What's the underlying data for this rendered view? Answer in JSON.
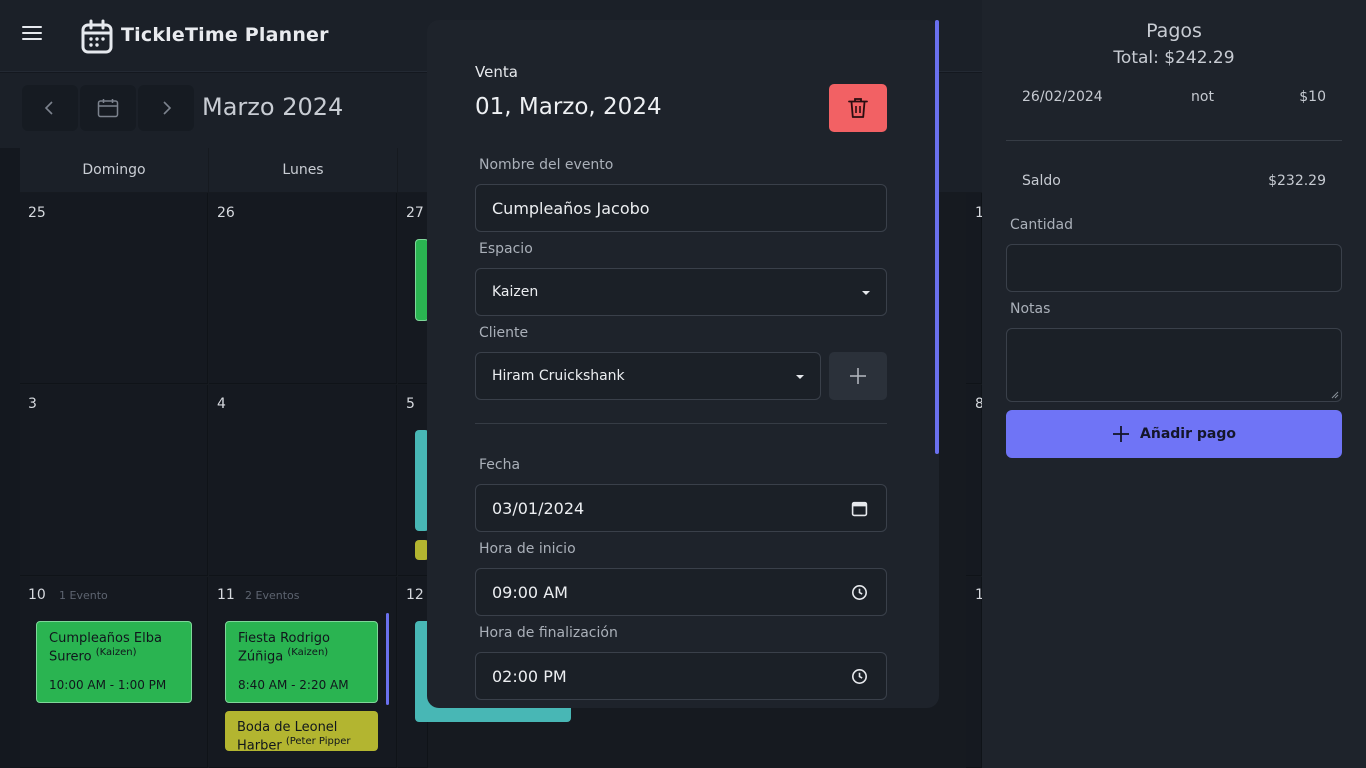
{
  "app": {
    "title": "TickleTime Planner"
  },
  "calendar": {
    "month_title": "Marzo 2024",
    "weekdays": [
      "Domingo",
      "Lunes"
    ],
    "cells": [
      {
        "day": "25"
      },
      {
        "day": "26"
      },
      {
        "day": "27"
      },
      {
        "day": "1"
      },
      {
        "day": "3"
      },
      {
        "day": "4"
      },
      {
        "day": "5"
      },
      {
        "day": "8"
      },
      {
        "day": "10",
        "count": "1 Evento"
      },
      {
        "day": "11",
        "count": "2 Eventos"
      },
      {
        "day": "12"
      },
      {
        "day": "1"
      }
    ],
    "events": [
      {
        "title": "Cumpleaños Elba Surero",
        "tag": "(Kaizen)",
        "time": "10:00 AM - 1:00 PM"
      },
      {
        "title": "Fiesta Rodrigo Zúñiga",
        "tag": "(Kaizen)",
        "time": "8:40 AM - 2:20 AM"
      },
      {
        "title": "Boda de Leonel Harber",
        "tag": "(Peter Pipper"
      }
    ],
    "colors": {
      "green": "#2ab451",
      "teal": "#48b7b5",
      "olive": "#b3b530"
    }
  },
  "modal": {
    "type": "Venta",
    "date": "01, Marzo, 2024",
    "fields": {
      "event_name_label": "Nombre del evento",
      "event_name_value": "Cumpleaños Jacobo",
      "space_label": "Espacio",
      "space_value": "Kaizen",
      "client_label": "Cliente",
      "client_value": "Hiram Cruickshank",
      "date_label": "Fecha",
      "date_value": "03/01/2024",
      "start_label": "Hora de inicio",
      "start_value": "09:00 AM",
      "end_label": "Hora de finalización",
      "end_value": "02:00 PM"
    },
    "delete_color": "#f26164"
  },
  "payments": {
    "title": "Pagos",
    "total": "Total: $242.29",
    "items": [
      {
        "date": "26/02/2024",
        "note": "not",
        "amount": "$10"
      }
    ],
    "balance_label": "Saldo",
    "balance_value": "$232.29",
    "amount_label": "Cantidad",
    "notes_label": "Notas",
    "add_button": "Añadir pago",
    "accent": "#6f74f6"
  }
}
